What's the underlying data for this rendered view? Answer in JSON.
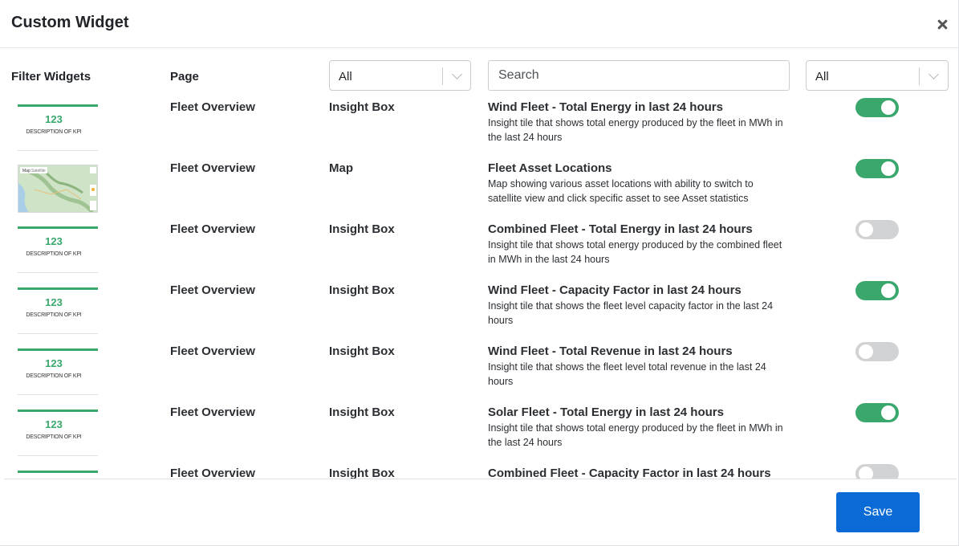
{
  "modal": {
    "title": "Custom Widget",
    "close_icon": "close-icon"
  },
  "filters": {
    "filter_label": "Filter Widgets",
    "page_label": "Page",
    "page_select": "All",
    "search_placeholder": "Search",
    "type_select": "All"
  },
  "kpi_thumb": {
    "number": "123",
    "description": "DESCRIPTION OF KPI"
  },
  "map_thumb": {
    "tab_map": "Map",
    "tab_satellite": "Satellite"
  },
  "widgets": [
    {
      "page": "Fleet Overview",
      "type": "Insight Box",
      "title": "Wind Fleet - Total Energy in last 24 hours",
      "description": "Insight tile that shows total energy produced by the fleet in MWh in the last 24 hours",
      "enabled": true
    },
    {
      "page": "Fleet Overview",
      "type": "Map",
      "title": "Fleet Asset Locations",
      "description": "Map showing various asset locations with ability to switch to satellite view and click specific asset to see Asset statistics",
      "enabled": true
    },
    {
      "page": "Fleet Overview",
      "type": "Insight Box",
      "title": "Combined Fleet - Total Energy in last 24 hours",
      "description": "Insight tile that shows total energy produced by the combined fleet in MWh in the last 24 hours",
      "enabled": false
    },
    {
      "page": "Fleet Overview",
      "type": "Insight Box",
      "title": "Wind Fleet - Capacity Factor in last 24 hours",
      "description": "Insight tile that shows the fleet level capacity factor in the last 24 hours",
      "enabled": true
    },
    {
      "page": "Fleet Overview",
      "type": "Insight Box",
      "title": "Wind Fleet - Total Revenue in last 24 hours",
      "description": "Insight tile that shows the fleet level total revenue in the last 24 hours",
      "enabled": false
    },
    {
      "page": "Fleet Overview",
      "type": "Insight Box",
      "title": "Solar Fleet - Total Energy in last 24 hours",
      "description": "Insight tile that shows total energy produced by the fleet in MWh in the last 24 hours",
      "enabled": true
    },
    {
      "page": "Fleet Overview",
      "type": "Insight Box",
      "title": "Combined Fleet - Capacity Factor in last 24 hours",
      "description": "",
      "enabled": false
    }
  ],
  "footer": {
    "save_label": "Save"
  },
  "colors": {
    "accent_green": "#3aa76d",
    "primary_blue": "#0b6bd6",
    "toggle_off": "#d0d2d4"
  }
}
